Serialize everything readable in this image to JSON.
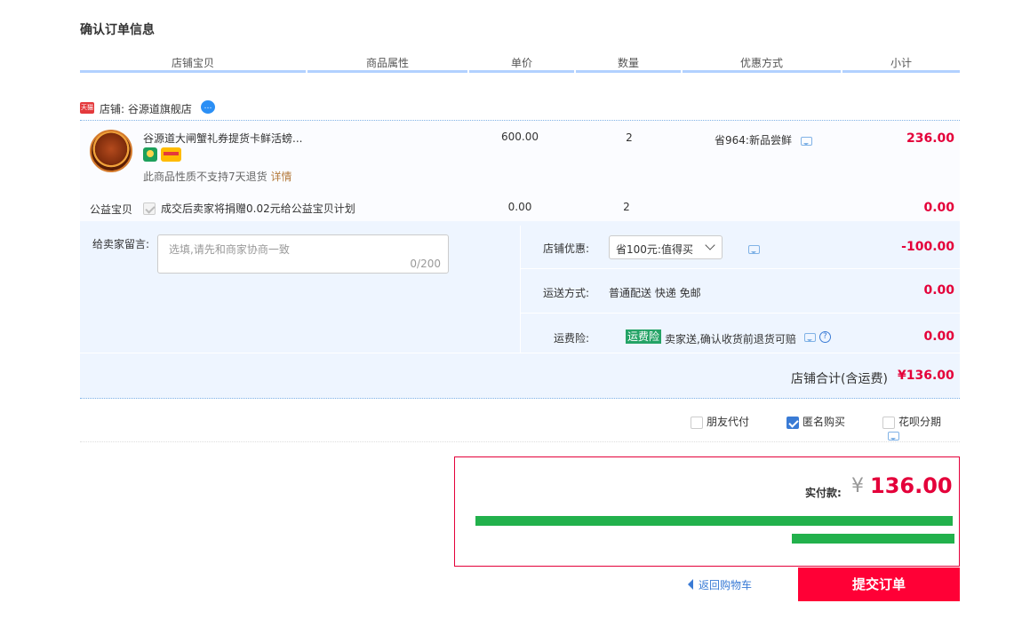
{
  "page_title": "确认订单信息",
  "table_headers": [
    "店铺宝贝",
    "商品属性",
    "单价",
    "数量",
    "优惠方式",
    "小计"
  ],
  "shop": {
    "logo_label": "天猫",
    "label": "店铺: 谷源道旗舰店",
    "im_icon": "chat-bubble-icon"
  },
  "item": {
    "name": "谷源道大闸蟹礼券提货卡鲜活螃...",
    "no_return_note": "此商品性质不支持7天退货",
    "detail_link": "详情",
    "price": "600.00",
    "quantity": "2",
    "promotion": "省964:新品尝鲜",
    "subtotal": "236.00"
  },
  "charity": {
    "label": "公益宝贝",
    "text": "成交后卖家将捐赠0.02元给公益宝贝计划",
    "price": "0.00",
    "quantity": "2",
    "subtotal": "0.00"
  },
  "message": {
    "label": "给卖家留言:",
    "placeholder": "选填,请先和商家协商一致",
    "count": "0/200"
  },
  "options": {
    "shop_discount": {
      "label": "店铺优惠:",
      "selected": "省100元:值得买",
      "value": "-100.00"
    },
    "shipping": {
      "label": "运送方式:",
      "text": "普通配送 快递 免邮",
      "value": "0.00"
    },
    "insurance": {
      "label": "运费险:",
      "tag": "运费险",
      "text": "卖家送,确认收货前退货可赔",
      "value": "0.00"
    }
  },
  "shop_total": {
    "label": "店铺合计(含运费)",
    "value": "¥136.00"
  },
  "extras": [
    {
      "label": "朋友代付",
      "checked": false
    },
    {
      "label": "匿名购买",
      "checked": true
    },
    {
      "label": "花呗分期",
      "checked": false
    }
  ],
  "payment": {
    "label": "实付款:",
    "currency": "¥",
    "amount": "136.00"
  },
  "back_link": "返回购物车",
  "submit_button": "提交订单",
  "colors": {
    "accent_red": "#ff0036",
    "price_red": "#e4003a",
    "header_rule": "#b2d1ff",
    "option_bg": "#eef5ff",
    "redaction": "#22b14c"
  }
}
